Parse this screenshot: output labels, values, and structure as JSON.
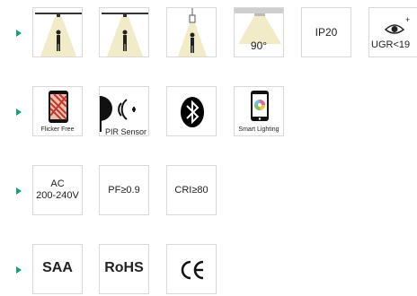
{
  "rows": [
    {
      "tiles": [
        {
          "name": "beam-person-light-tile-1"
        },
        {
          "name": "beam-person-light-tile-2"
        },
        {
          "name": "pendant-person-light-tile"
        },
        {
          "name": "beam-angle-tile",
          "label": "90°"
        },
        {
          "name": "ip-rating-tile",
          "label": "IP20"
        },
        {
          "name": "ugr-tile",
          "label": "UGR<19"
        }
      ]
    },
    {
      "tiles": [
        {
          "name": "flicker-free-tile",
          "label": "Flicker Free"
        },
        {
          "name": "pir-sensor-tile",
          "label": "PIR Sensor"
        },
        {
          "name": "bluetooth-tile"
        },
        {
          "name": "smart-lighting-tile",
          "label": "Smart Lighting"
        }
      ]
    },
    {
      "tiles": [
        {
          "name": "voltage-tile",
          "line1": "AC",
          "line2": "200-240V"
        },
        {
          "name": "power-factor-tile",
          "label": "PF≥0.9"
        },
        {
          "name": "cri-tile",
          "label": "CRI≥80"
        }
      ]
    },
    {
      "tiles": [
        {
          "name": "saa-tile",
          "label": "SAA"
        },
        {
          "name": "rohs-tile",
          "label": "RoHS"
        },
        {
          "name": "ce-tile",
          "label": "CE"
        }
      ]
    }
  ],
  "colors": {
    "bullet": "#1a9e78",
    "light_beam": "#f1ebc8",
    "bluetooth_bg": "#000000",
    "flicker_red": "#c0392b"
  }
}
